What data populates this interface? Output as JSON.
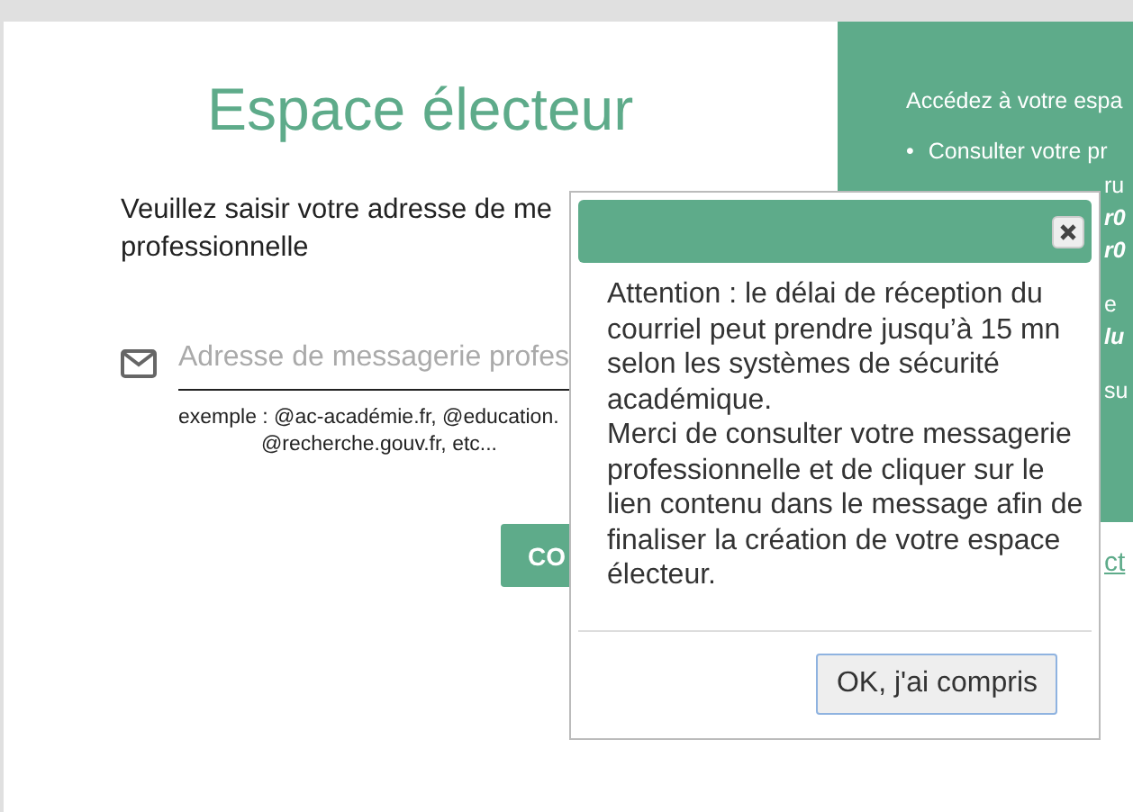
{
  "title": "Espace électeur",
  "instruction": "Veuillez saisir votre adresse de me professionnelle",
  "email_field": {
    "placeholder": "Adresse de messagerie profes"
  },
  "example_hint": [
    "exemple : @ac-académie.fr, @education.",
    "@recherche.gouv.fr, etc..."
  ],
  "submit_button": "CO",
  "info_panel": {
    "intro": "Accédez à votre espa",
    "bullets": [
      {
        "marker": "•",
        "text": "Consulter votre pr"
      }
    ],
    "fragments": [
      {
        "text": "ru",
        "kind": "plain"
      },
      {
        "text": "r0",
        "kind": "emphasis"
      },
      {
        "text": "r0",
        "kind": "emphasis"
      },
      {
        "text": "e",
        "kind": "plain"
      },
      {
        "text": "lu",
        "kind": "emphasis"
      },
      {
        "text": "su",
        "kind": "plain"
      }
    ]
  },
  "link": "ct",
  "dialog": {
    "paragraphs": [
      "Attention : le délai de réception du courriel peut prendre jusqu’à 15 mn selon les systèmes de sécurité académique.",
      "Merci de consulter votre messagerie professionnelle et de cliquer sur le lien contenu dans le message afin de finaliser la création de votre espace électeur."
    ],
    "ok_button": "OK, j'ai compris"
  }
}
